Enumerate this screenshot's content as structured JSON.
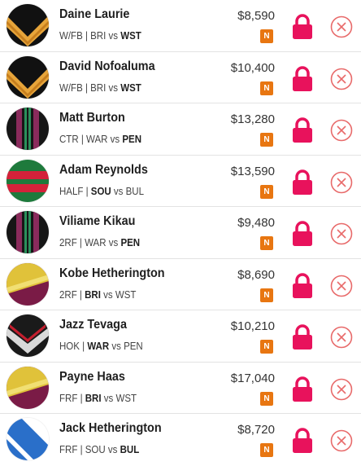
{
  "colors": {
    "accent": "#e8125c",
    "badge": "#e87611",
    "remove": "#e86a6a"
  },
  "players": [
    {
      "name": "Daine Laurie",
      "position": "W/FB",
      "team": "BRI",
      "vs": "vs",
      "opponent": "WST",
      "bold": "opp",
      "price": "$8,590",
      "badge": "N",
      "jersey": "tigers"
    },
    {
      "name": "David Nofoaluma",
      "position": "W/FB",
      "team": "BRI",
      "vs": "vs",
      "opponent": "WST",
      "bold": "opp",
      "price": "$10,400",
      "badge": "N",
      "jersey": "tigers"
    },
    {
      "name": "Matt Burton",
      "position": "CTR",
      "team": "WAR",
      "vs": "vs",
      "opponent": "PEN",
      "bold": "opp",
      "price": "$13,280",
      "badge": "N",
      "jersey": "panthers"
    },
    {
      "name": "Adam Reynolds",
      "position": "HALF",
      "team": "SOU",
      "vs": "vs",
      "opponent": "BUL",
      "bold": "team",
      "price": "$13,590",
      "badge": "N",
      "jersey": "rabbitohs"
    },
    {
      "name": "Viliame Kikau",
      "position": "2RF",
      "team": "WAR",
      "vs": "vs",
      "opponent": "PEN",
      "bold": "opp",
      "price": "$9,480",
      "badge": "N",
      "jersey": "panthers"
    },
    {
      "name": "Kobe Hetherington",
      "position": "2RF",
      "team": "BRI",
      "vs": "vs",
      "opponent": "WST",
      "bold": "team",
      "price": "$8,690",
      "badge": "N",
      "jersey": "broncos"
    },
    {
      "name": "Jazz Tevaga",
      "position": "HOK",
      "team": "WAR",
      "vs": "vs",
      "opponent": "PEN",
      "bold": "team",
      "price": "$10,210",
      "badge": "N",
      "jersey": "warriors"
    },
    {
      "name": "Payne Haas",
      "position": "FRF",
      "team": "BRI",
      "vs": "vs",
      "opponent": "WST",
      "bold": "team",
      "price": "$17,040",
      "badge": "N",
      "jersey": "broncos"
    },
    {
      "name": "Jack Hetherington",
      "position": "FRF",
      "team": "SOU",
      "vs": "vs",
      "opponent": "BUL",
      "bold": "opp",
      "price": "$8,720",
      "badge": "N",
      "jersey": "bulldogs"
    }
  ]
}
